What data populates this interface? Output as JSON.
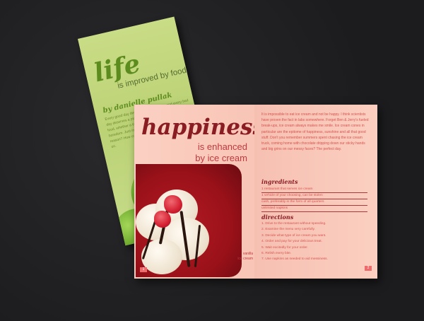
{
  "left_booklet": {
    "title": "life",
    "subtitle": "is improved by food",
    "byline": "by danielle pullak",
    "body": "Every good day deserves a celebration, and every bad day deserves a pick-me-up. Life is simply better with food, whether a triumph and relaxation of ever-changing boredom. Just imagine a meal. But what meal for which reason? How could we go without? Don't worry. Read on."
  },
  "right_booklet": {
    "title": "happiness",
    "subtitle": "is enhanced\nby ice cream",
    "caption": "vanilla\nice cream",
    "page_left": "1",
    "page_right": "2",
    "intro": "It is impossible to eat ice cream and not be happy. I think scientists have proven the fact in labs somewhere. Forget Ben & Jerry's fueled break-ups, ice cream always makes me smile. Ice cream cones in particular are the epitome of happiness, sunshine and all that good stuff. Don't you remember summers spent chasing the ice cream truck, coming home with chocolate dripping down our sticky hands and big grins on our messy faces? The perfect day.",
    "ingredients_title": "ingredients",
    "ingredients": [
      "1 restaurant that serves ice cream",
      "1 vehicle of your choosing, can be stolen",
      "cash, preferably in the form of all quarters",
      "unlimited napkins"
    ],
    "directions_title": "directions",
    "directions": [
      "1.  Drive to the restaurant without speeding.",
      "2.  Examine the menu very carefully.",
      "3.  Decide what type of ice cream you want.",
      "4.  Order and pay for your delicious treat.",
      "5.  Wait excitedly for your order.",
      "6.  Relish every bite.",
      "7.  Use napkins as needed to aid messiness."
    ]
  },
  "colors": {
    "green_cover": "#c9dc86",
    "green_title": "#5d8c1e",
    "pink_page": "#fbd0c2",
    "dark_red": "#8a1c24",
    "accent_red": "#d9534f"
  }
}
